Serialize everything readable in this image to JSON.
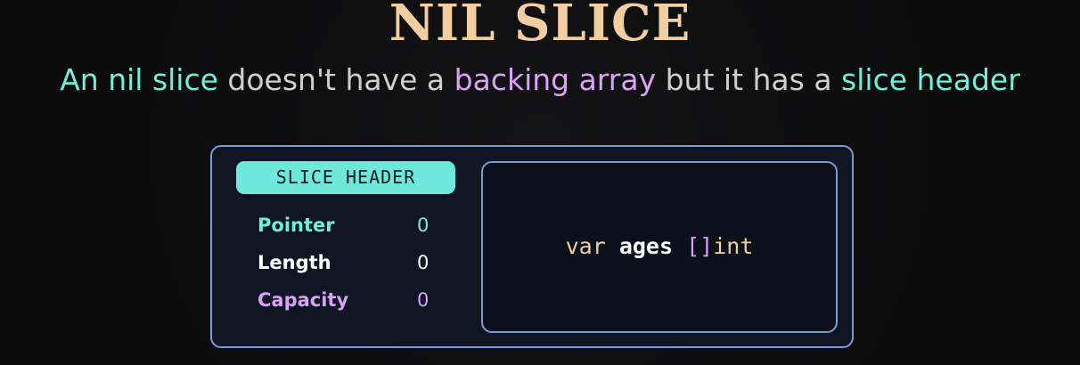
{
  "title": "NIL SLICE",
  "subtitle": {
    "part1": "An nil slice",
    "part2": " doesn't have a ",
    "part3": "backing array",
    "part4": " but it has a ",
    "part5": "slice header"
  },
  "slice_header": {
    "label": "SLICE HEADER",
    "fields": [
      {
        "name": "Pointer",
        "value": "0",
        "color": "#6ff0da"
      },
      {
        "name": "Length",
        "value": "0",
        "color": "#ffffff"
      },
      {
        "name": "Capacity",
        "value": "0",
        "color": "#d9a3f5"
      }
    ]
  },
  "code": {
    "keyword": "var",
    "identifier": "ages",
    "brackets": "[]",
    "type": "int"
  }
}
